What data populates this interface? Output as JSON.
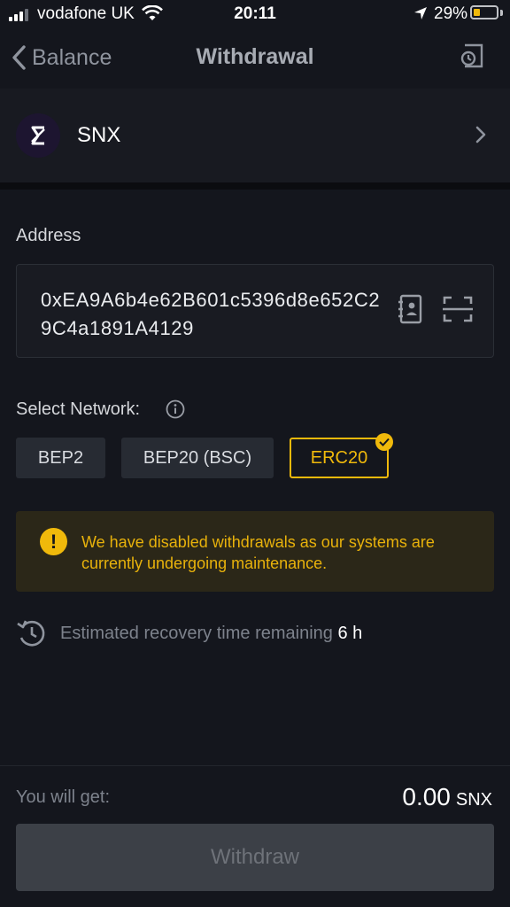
{
  "status_bar": {
    "carrier": "vodafone UK",
    "time": "20:11",
    "battery_percent": "29%",
    "battery_level": 0.29,
    "signal_bars_filled": 3,
    "signal_bars_total": 4,
    "icons": [
      "signal-icon",
      "wifi-icon",
      "location-arrow-icon",
      "battery-icon"
    ]
  },
  "nav": {
    "back_label": "Balance",
    "title": "Withdrawal",
    "icons": [
      "back-chevron-icon",
      "history-icon"
    ]
  },
  "coin": {
    "symbol": "SNX",
    "icons": [
      "snx-logo-icon",
      "chevron-right-icon"
    ]
  },
  "address": {
    "label": "Address",
    "value": "0xEA9A6b4e62B601c5396d8e652C29C4a1891A4129",
    "icons": [
      "address-book-icon",
      "scan-icon"
    ]
  },
  "network": {
    "label": "Select Network:",
    "options": [
      {
        "label": "BEP2",
        "selected": false
      },
      {
        "label": "BEP20 (BSC)",
        "selected": false
      },
      {
        "label": "ERC20",
        "selected": true
      }
    ],
    "icons": [
      "info-icon",
      "checkmark-icon"
    ]
  },
  "warning": {
    "text": "We have disabled withdrawals as our systems are currently undergoing maintenance.",
    "icon": "exclamation-icon"
  },
  "recovery": {
    "text": "Estimated recovery time remaining",
    "value": "6 h",
    "icon": "recovery-clock-icon"
  },
  "footer": {
    "get_label": "You will get:",
    "amount": "0.00",
    "unit": "SNX",
    "withdraw_label": "Withdraw"
  },
  "colors": {
    "background": "#14161d",
    "accent": "#f0b90b",
    "warning_bg": "#2b2718",
    "button_disabled": "#3c4047"
  }
}
